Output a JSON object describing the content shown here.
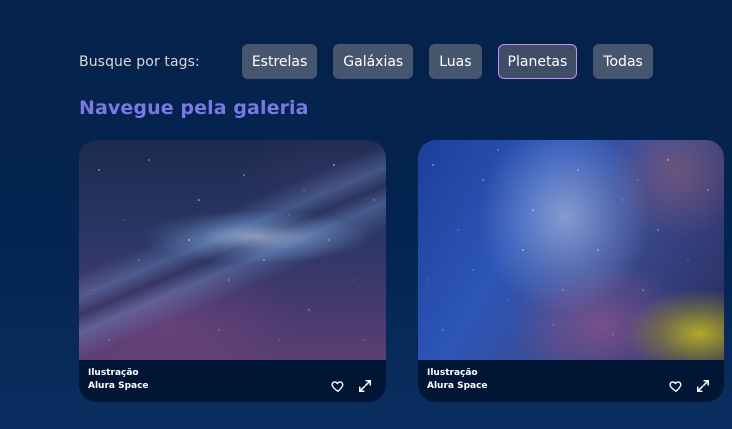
{
  "tags": {
    "label": "Busque por tags:",
    "items": [
      {
        "label": "Estrelas",
        "active": false
      },
      {
        "label": "Galáxias",
        "active": false
      },
      {
        "label": "Luas",
        "active": false
      },
      {
        "label": "Planetas",
        "active": true
      },
      {
        "label": "Todas",
        "active": false
      }
    ]
  },
  "gallery": {
    "title": "Navegue pela galeria",
    "cards": [
      {
        "title": "Ilustração",
        "source": "Alura Space",
        "icons": [
          "heart-icon",
          "expand-icon"
        ]
      },
      {
        "title": "Ilustração",
        "source": "Alura Space",
        "icons": [
          "heart-icon",
          "expand-icon"
        ]
      }
    ]
  },
  "colors": {
    "background": "#04224a",
    "tag_background": "#47566f",
    "tag_active_border": "#c98cf1",
    "title_accent": "#7b78e5",
    "card_footer": "#001634"
  }
}
